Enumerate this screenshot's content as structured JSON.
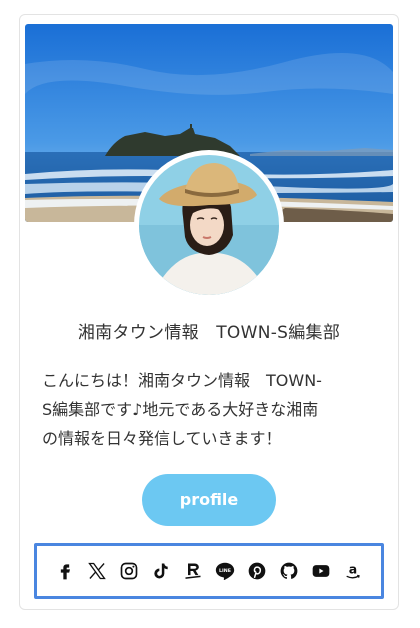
{
  "profile": {
    "name": "湘南タウン情報　TOWN-S編集部",
    "bio": "こんにちは！湘南タウン情報　TOWN-\nS編集部です♪地元である大好きな湘南\nの情報を日々発信していきます！",
    "button_label": "profile"
  },
  "social_icons": [
    "facebook-icon",
    "x-icon",
    "instagram-icon",
    "tiktok-icon",
    "rakuten-icon",
    "line-icon",
    "pinterest-icon",
    "github-icon",
    "youtube-icon",
    "amazon-icon"
  ],
  "colors": {
    "accent": "#6cc8f2",
    "border_highlight": "#4a86e0",
    "text": "#333333"
  }
}
